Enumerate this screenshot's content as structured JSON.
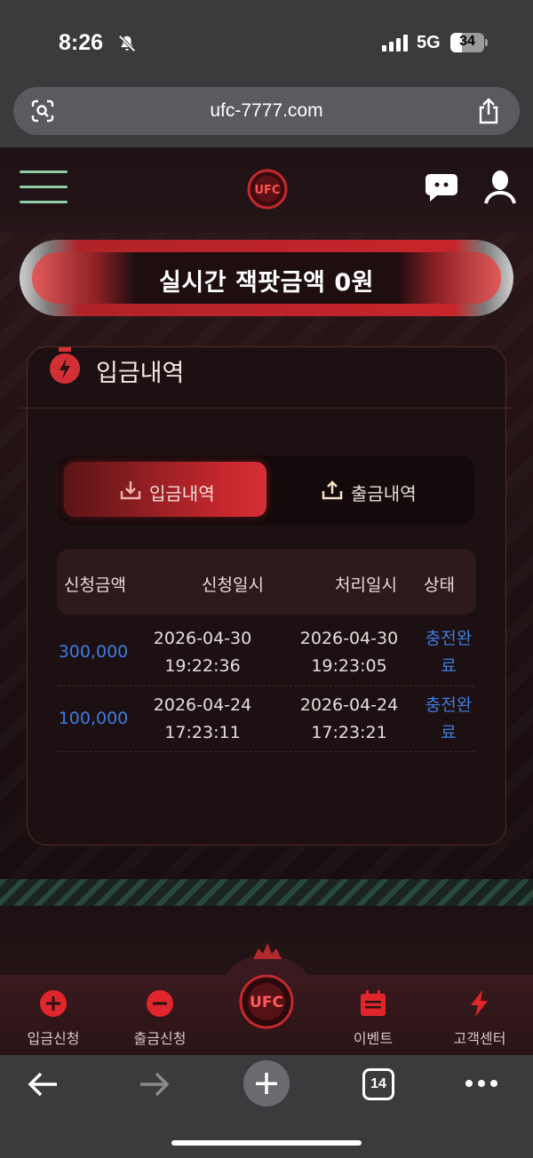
{
  "status_bar": {
    "time": "8:26",
    "network": "5G",
    "battery": "34"
  },
  "browser": {
    "url": "ufc-7777.com",
    "tab_count": "14"
  },
  "jackpot": {
    "label": "실시간 잭팟금액",
    "amount": "0원"
  },
  "card": {
    "title": "입금내역",
    "tabs": [
      {
        "label": "입금내역",
        "active": true
      },
      {
        "label": "출금내역",
        "active": false
      }
    ],
    "columns": [
      "신청금액",
      "신청일시",
      "처리일시",
      "상태"
    ],
    "rows": [
      {
        "amount": "300,000",
        "requested_date": "2026-04-30",
        "requested_time": "19:22:36",
        "processed_date": "2026-04-30",
        "processed_time": "19:23:05",
        "status_line1": "충전완",
        "status_line2": "료"
      },
      {
        "amount": "100,000",
        "requested_date": "2026-04-24",
        "requested_time": "17:23:11",
        "processed_date": "2026-04-24",
        "processed_time": "17:23:21",
        "status_line1": "충전완",
        "status_line2": "료"
      }
    ]
  },
  "bottom_nav": {
    "items": [
      {
        "label": "입금신청",
        "icon": "plus-circle-icon"
      },
      {
        "label": "출금신청",
        "icon": "minus-circle-icon"
      },
      {
        "label": "이벤트",
        "icon": "calendar-icon"
      },
      {
        "label": "고객센터",
        "icon": "lightning-icon"
      }
    ]
  },
  "colors": {
    "accent_red": "#c7282e",
    "link_blue": "#3d7ce0",
    "hamburger_green": "#8fd0a6"
  }
}
